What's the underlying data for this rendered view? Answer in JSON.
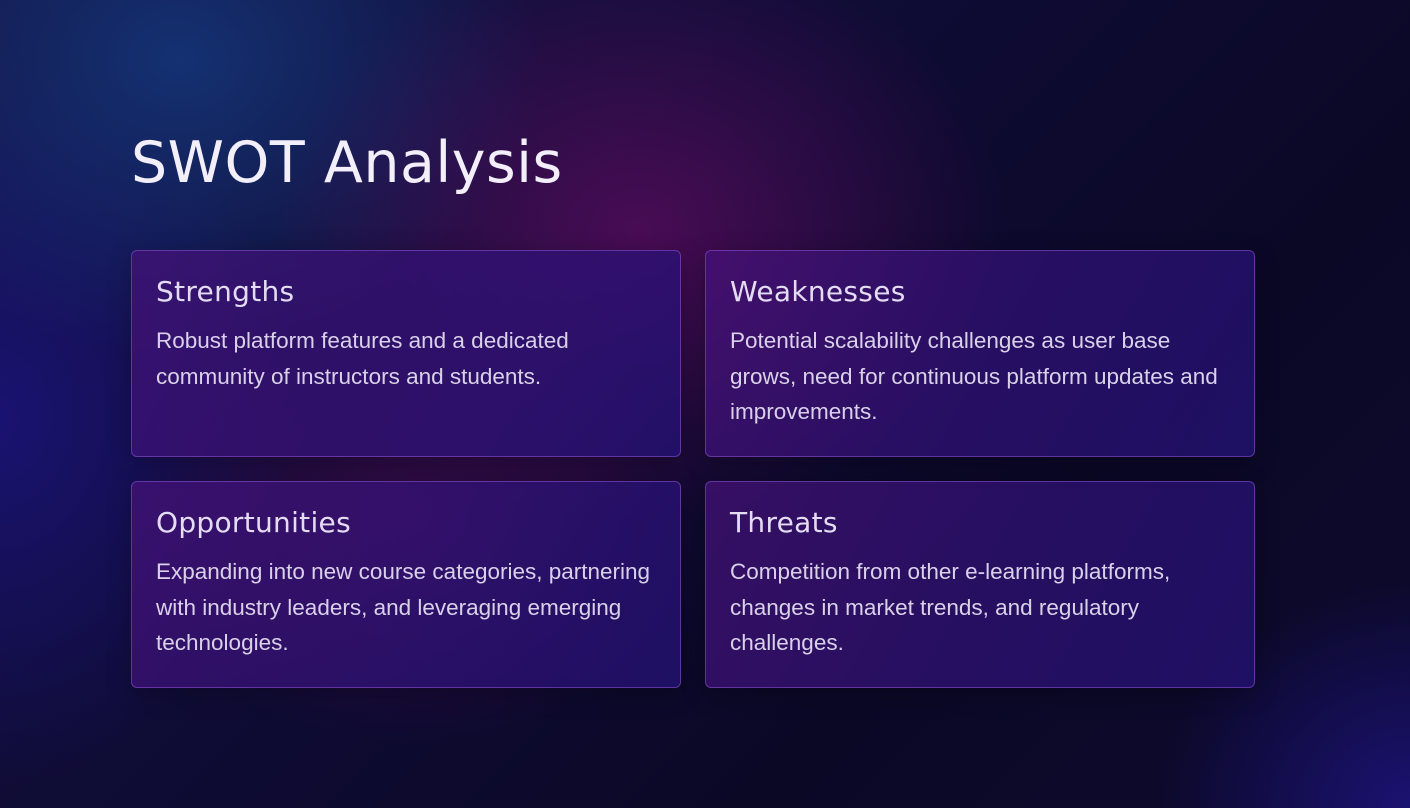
{
  "slide": {
    "title": "SWOT Analysis",
    "quadrants": [
      {
        "title": "Strengths",
        "body": "Robust platform features and a dedicated community of instructors and students."
      },
      {
        "title": "Weaknesses",
        "body": "Potential scalability challenges as user base grows, need for continuous platform updates and improvements."
      },
      {
        "title": "Opportunities",
        "body": "Expanding into new course categories, partnering with industry leaders, and leveraging emerging technologies."
      },
      {
        "title": "Threats",
        "body": "Competition from other e-learning platforms, changes in market trends, and regulatory challenges."
      }
    ]
  },
  "colors": {
    "background": "#0d0a2e",
    "magenta_glow": "#780c6e",
    "card_fill": "#301278",
    "card_border": "#965adc",
    "title_text": "#f2eefa",
    "body_text": "#d9d1ea"
  }
}
